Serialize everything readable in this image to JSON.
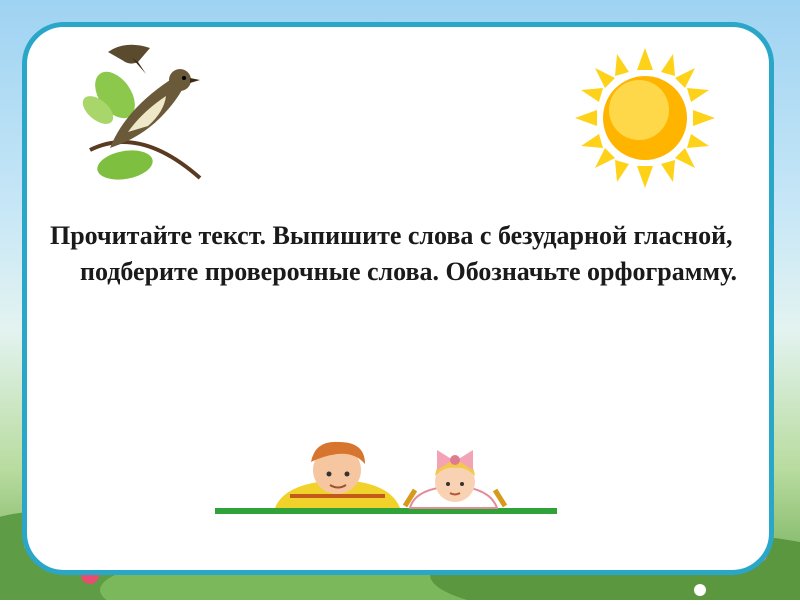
{
  "slide": {
    "instruction": "Прочитайте текст. Выпишите слова с безударной гласной, подберите проверочные слова. Обозначьте орфограмму.",
    "accent_color": "#2aa6c8",
    "icons": [
      "bird-on-branch-icon",
      "sun-icon",
      "children-peeking-icon"
    ]
  }
}
